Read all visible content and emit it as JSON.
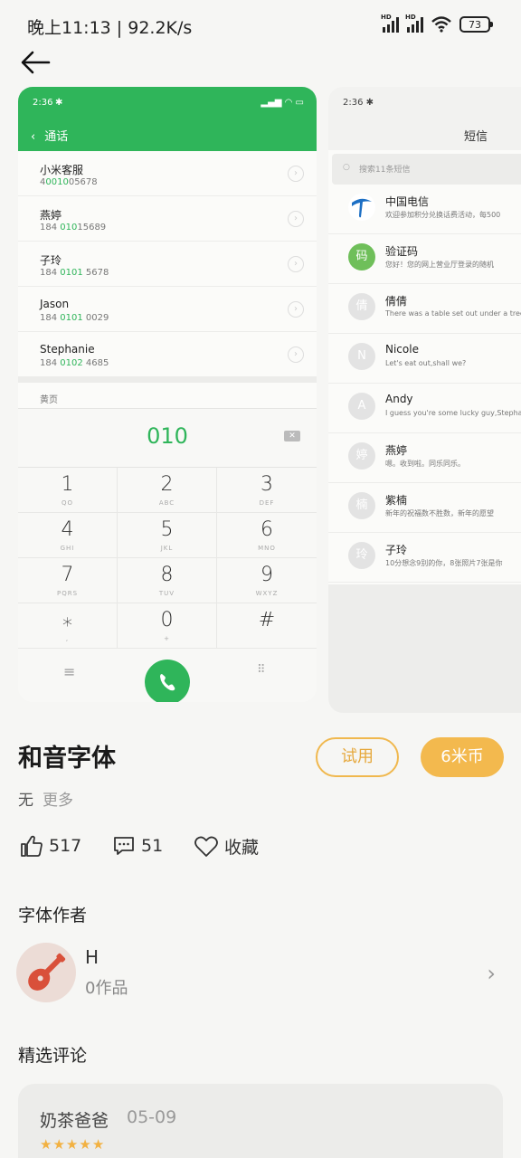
{
  "status_bar": {
    "time_speed": "晚上11:13 | 92.2K/s",
    "battery": "73",
    "signal_tag": "HD"
  },
  "preview_dialer": {
    "time": "2:36",
    "title": "通话",
    "contacts": [
      {
        "name": "小米客服",
        "phone_pre": "4",
        "phone_hl": "0010",
        "phone_post": "05678"
      },
      {
        "name": "燕婷",
        "phone_pre": "184 ",
        "phone_hl": "010",
        "phone_post": "15689"
      },
      {
        "name": "子玲",
        "phone_pre": "184 ",
        "phone_hl": "0101",
        "phone_post": " 5678"
      },
      {
        "name": "Jason",
        "phone_pre": "184 ",
        "phone_hl": "0101",
        "phone_post": " 0029"
      },
      {
        "name": "Stephanie",
        "phone_pre": "184 ",
        "phone_hl": "0102",
        "phone_post": " 4685"
      }
    ],
    "section": "黄页",
    "entered_number": "010",
    "keys": [
      {
        "digit": "1",
        "letters": "QO"
      },
      {
        "digit": "2",
        "letters": "ABC"
      },
      {
        "digit": "3",
        "letters": "DEF"
      },
      {
        "digit": "4",
        "letters": "GHI"
      },
      {
        "digit": "5",
        "letters": "JKL"
      },
      {
        "digit": "6",
        "letters": "MNO"
      },
      {
        "digit": "7",
        "letters": "PQRS"
      },
      {
        "digit": "8",
        "letters": "TUV"
      },
      {
        "digit": "9",
        "letters": "WXYZ"
      },
      {
        "digit": "⁎",
        "letters": ","
      },
      {
        "digit": "0",
        "letters": "+"
      },
      {
        "digit": "#",
        "letters": ""
      }
    ]
  },
  "preview_sms": {
    "time": "2:36",
    "title": "短信",
    "search_placeholder": "搜索11条短信",
    "messages": [
      {
        "avatar": "",
        "name": "中国电信",
        "preview": "欢迎参加积分兑换话费活动，每500"
      },
      {
        "avatar": "码",
        "name": "验证码",
        "preview": "您好！您的网上营业厅登录的随机"
      },
      {
        "avatar": "倩",
        "name": "倩倩",
        "preview": "There was a table set out under a tree in fro"
      },
      {
        "avatar": "N",
        "name": "Nicole",
        "preview": "Let's eat out,shall we?"
      },
      {
        "avatar": "A",
        "name": "Andy",
        "preview": "I guess you're some lucky guy,Stephanie is a"
      },
      {
        "avatar": "婷",
        "name": "燕婷",
        "preview": "嗯。收到啦。同乐同乐。"
      },
      {
        "avatar": "楠",
        "name": "紫楠",
        "preview": "新年的祝福数不胜数，新年的愿望"
      },
      {
        "avatar": "玲",
        "name": "子玲",
        "preview": "10分想念9别的你，8张照片7张是你"
      }
    ]
  },
  "font": {
    "name": "和音字体",
    "try_label": "试用",
    "price_label": "6米币",
    "description": "无",
    "more_label": "更多",
    "likes": "517",
    "comments": "51",
    "favorite_label": "收藏"
  },
  "author_section": {
    "title": "字体作者",
    "name": "H",
    "works": "0作品"
  },
  "reviews_section": {
    "title": "精选评论",
    "reviews": [
      {
        "user": "奶茶爸爸",
        "date": "05-09",
        "stars": 5
      }
    ]
  },
  "colors": {
    "green": "#2fb55a",
    "accent": "#f3b94e"
  }
}
